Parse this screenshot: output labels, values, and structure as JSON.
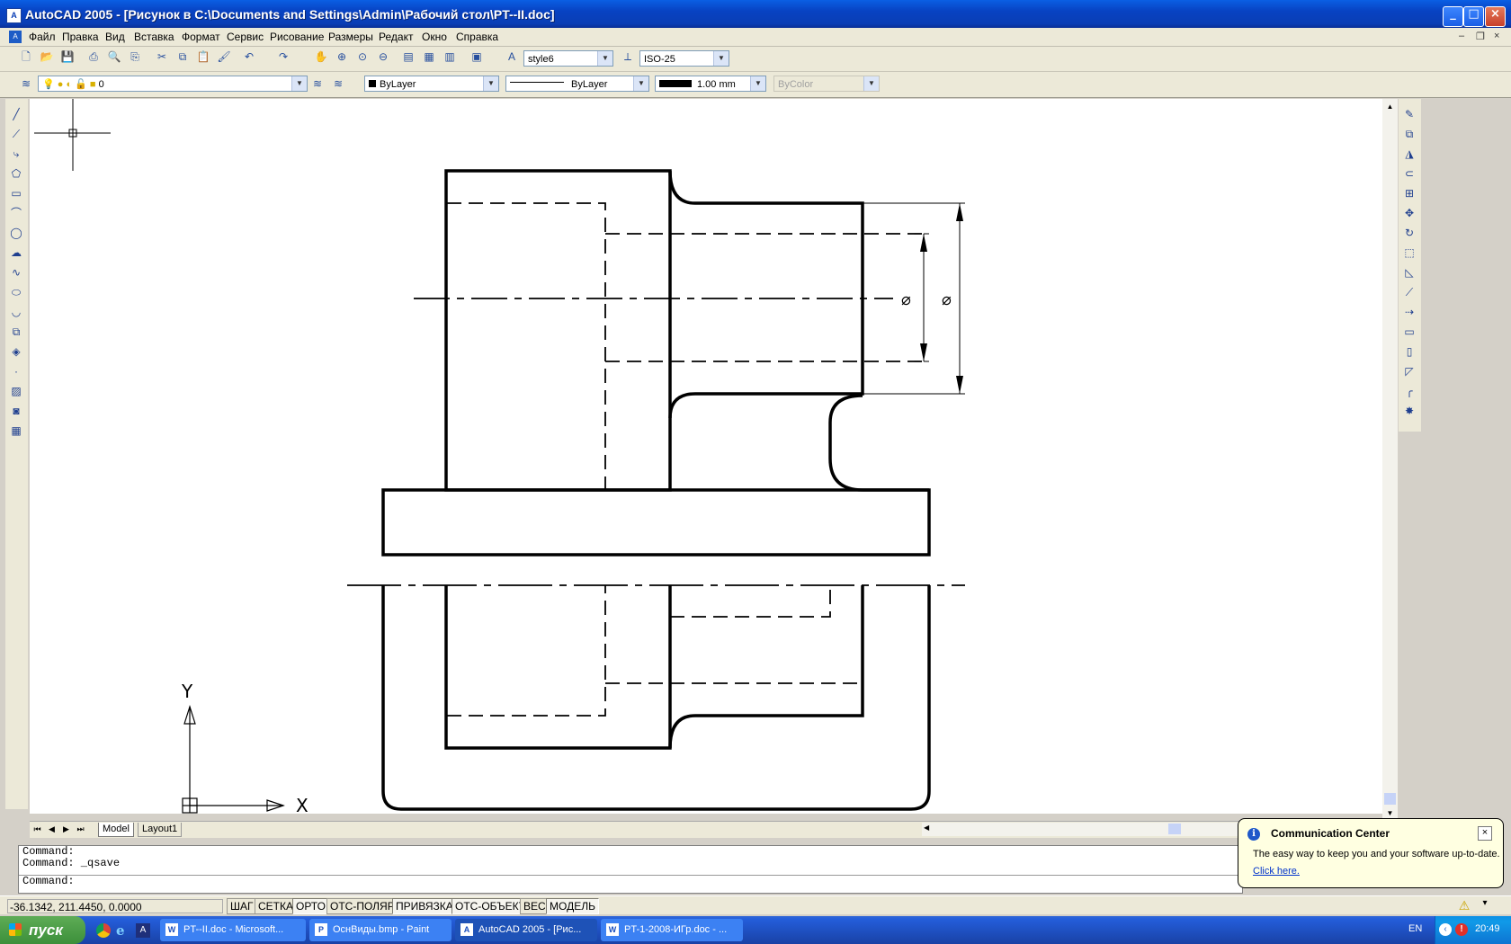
{
  "window": {
    "title": "AutoCAD 2005 - [Рисунок в C:\\Documents and Settings\\Admin\\Рабочий стол\\PT--II.doc]",
    "app_icon": "autocad-icon"
  },
  "menu": {
    "items": [
      "Файл",
      "Правка",
      "Вид",
      "Вставка",
      "Формат",
      "Сервис",
      "Рисование",
      "Размеры",
      "Редакт",
      "Окно",
      "Справка"
    ]
  },
  "styles_toolbar": {
    "text_style": "style6",
    "dim_style": "ISO-25"
  },
  "layers_toolbar": {
    "layer": "0",
    "color": "ByLayer",
    "linetype": "ByLayer",
    "lineweight": "1.00 mm",
    "plotstyle": "ByColor"
  },
  "drawing": {
    "dim_symbol_1": "⌀",
    "dim_symbol_2": "⌀",
    "ucs_x": "X",
    "ucs_y": "Y"
  },
  "tabs": [
    "Model",
    "Layout1"
  ],
  "command_lines": [
    "Command:",
    "Command: _qsave",
    "Command:"
  ],
  "status": {
    "coords": "-36.1342, 211.4450, 0.0000",
    "buttons": [
      "ШАГ",
      "СЕТКА",
      "ОРТО",
      "ОТС-ПОЛЯР",
      "ПРИВЯЗКА",
      "ОТС-ОБЪЕКТ",
      "ВЕС",
      "МОДЕЛЬ"
    ],
    "on_buttons": [
      "ОРТО",
      "ПРИВЯЗКА",
      "ОТС-ОБЪЕКТ",
      "МОДЕЛЬ"
    ]
  },
  "balloon": {
    "title": "Communication Center",
    "text": "The easy way to keep you and your software up-to-date.",
    "link": "Click here."
  },
  "taskbar": {
    "start": "пуск",
    "tasks": [
      {
        "label": "PT--II.doc - Microsoft...",
        "icon": "word-icon",
        "active": false
      },
      {
        "label": "ОснВиды.bmp - Paint",
        "icon": "paint-icon",
        "active": false
      },
      {
        "label": "AutoCAD 2005 - [Рис...",
        "icon": "autocad-icon",
        "active": true
      },
      {
        "label": "PT-1-2008-ИГр.doc - ...",
        "icon": "word-icon",
        "active": false
      }
    ],
    "lang": "EN",
    "clock": "20:49"
  },
  "colors": {
    "titlebar": "#0a3eb5",
    "canvas": "#ffffff",
    "taskbar": "#245edb",
    "start": "#3c8f3a",
    "balloon": "#ffffe1"
  }
}
